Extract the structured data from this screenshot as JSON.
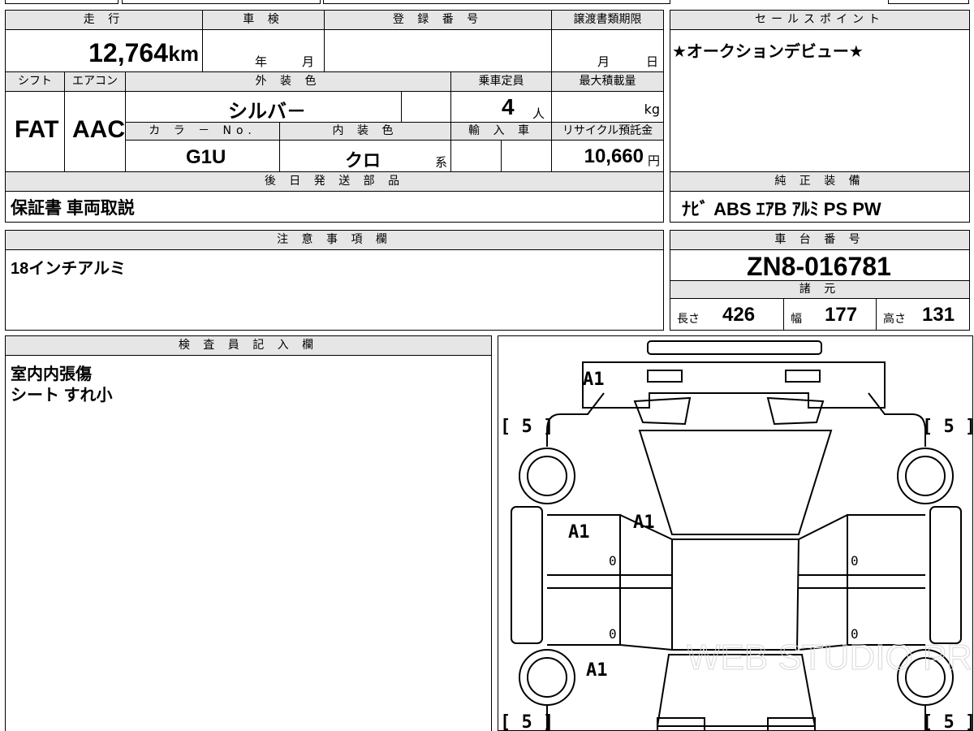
{
  "vehicle": {
    "mileage_header": "走 行",
    "mileage_value": "12,764",
    "mileage_unit": "km",
    "shaken_header": "車 検",
    "shaken_year": "年",
    "shaken_month": "月",
    "reg_header": "登 録 番 号",
    "transfer_header": "譲渡書類期限",
    "transfer_month": "月",
    "transfer_day": "日",
    "shift_header": "シフト",
    "shift_value": "FAT",
    "ac_header": "エアコン",
    "ac_value": "AAC",
    "exterior_header": "外 装 色",
    "exterior_value": "シルバ－",
    "capacity_header": "乗車定員",
    "capacity_value": "4",
    "capacity_unit": "人",
    "load_header": "最大積載量",
    "load_unit": "kg",
    "color_no_header": "カ ラ － No.",
    "color_no_value": "G1U",
    "interior_header": "内 装 色",
    "interior_value": "クロ",
    "interior_suffix": "系",
    "import_header": "輸 入 車",
    "recycle_header": "リサイクル預託金",
    "recycle_value": "10,660",
    "recycle_unit": "円"
  },
  "later_parts": {
    "header": "後 日 発 送 部 品",
    "value": "保証書 車両取説"
  },
  "sales_point": {
    "header": "セールスポイント",
    "value": "★オークションデビュー★"
  },
  "equipment": {
    "header": "純 正 装 備",
    "value": "ﾅﾋﾞ ABS ｴｱB ｱﾙﾐ PS PW"
  },
  "notes": {
    "header": "注 意 事 項 欄",
    "value": "18インチアルミ"
  },
  "chassis": {
    "header": "車 台 番 号",
    "value": "ZN8-016781"
  },
  "specs": {
    "header": "諸 元",
    "length_label": "長さ",
    "length_value": "426",
    "width_label": "幅",
    "width_value": "177",
    "height_label": "高さ",
    "height_value": "131"
  },
  "inspector": {
    "header": "検 査 員 記 入 欄",
    "line1": "室内内張傷",
    "line2": "シート すれ小"
  },
  "diagram": {
    "tire_tl": "[ 5 ]",
    "tire_tr": "[ 5 ]",
    "tire_bl": "[ 5 ]",
    "tire_br": "[ 5 ]",
    "mark_front": "A1",
    "mark_left_door": "A1",
    "mark_windshield": "A1",
    "mark_rear_left": "A1",
    "zero1": "0",
    "zero2": "0",
    "zero3": "0",
    "zero4": "0",
    "watermark": "WEB STUDIO PRO"
  }
}
